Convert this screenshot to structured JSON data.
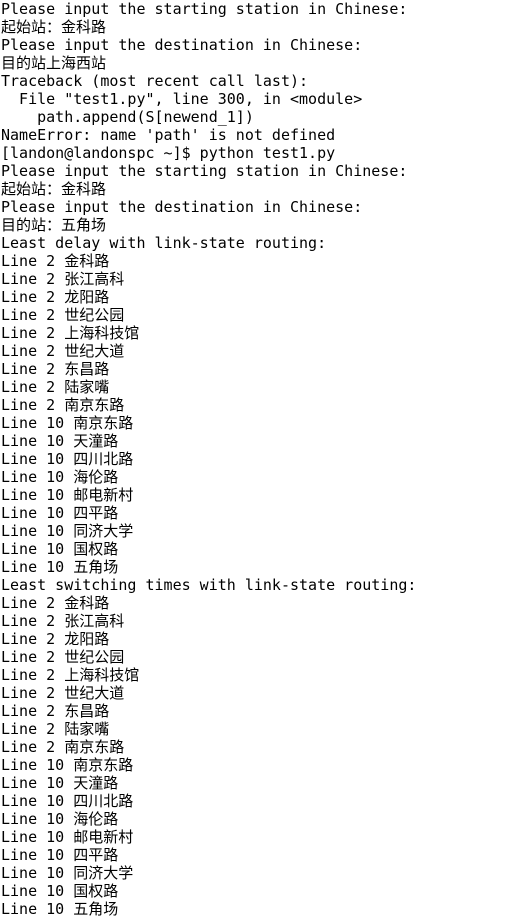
{
  "terminal": {
    "text_color": "#000000",
    "background_color": "#ffffff",
    "lines": [
      "Please input the starting station in Chinese:",
      "起始站：金科路",
      "Please input the destination in Chinese:",
      "目的站上海西站",
      "Traceback (most recent call last):",
      "  File \"test1.py\", line 300, in <module>",
      "    path.append(S[newend_1])",
      "NameError: name 'path' is not defined",
      "[landon@landonspc ~]$ python test1.py",
      "Please input the starting station in Chinese:",
      "起始站：金科路",
      "Please input the destination in Chinese:",
      "目的站：五角场",
      "Least delay with link-state routing:",
      "Line 2 金科路",
      "Line 2 张江高科",
      "Line 2 龙阳路",
      "Line 2 世纪公园",
      "Line 2 上海科技馆",
      "Line 2 世纪大道",
      "Line 2 东昌路",
      "Line 2 陆家嘴",
      "Line 2 南京东路",
      "Line 10 南京东路",
      "Line 10 天潼路",
      "Line 10 四川北路",
      "Line 10 海伦路",
      "Line 10 邮电新村",
      "Line 10 四平路",
      "Line 10 同济大学",
      "Line 10 国权路",
      "Line 10 五角场",
      "Least switching times with link-state routing:",
      "Line 2 金科路",
      "Line 2 张江高科",
      "Line 2 龙阳路",
      "Line 2 世纪公园",
      "Line 2 上海科技馆",
      "Line 2 世纪大道",
      "Line 2 东昌路",
      "Line 2 陆家嘴",
      "Line 2 南京东路",
      "Line 10 南京东路",
      "Line 10 天潼路",
      "Line 10 四川北路",
      "Line 10 海伦路",
      "Line 10 邮电新村",
      "Line 10 四平路",
      "Line 10 同济大学",
      "Line 10 国权路",
      "Line 10 五角场"
    ]
  }
}
